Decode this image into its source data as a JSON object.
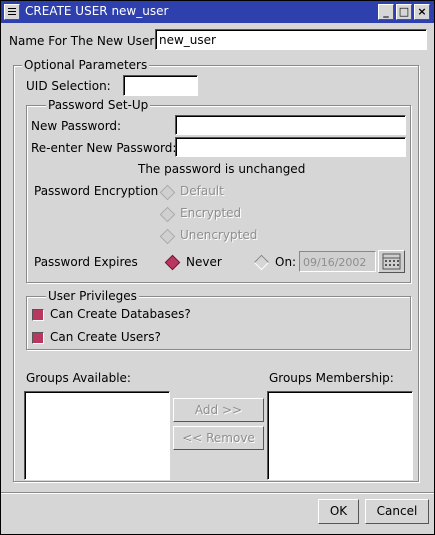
{
  "window": {
    "title": "CREATE USER new_user"
  },
  "name_row": {
    "label": "Name For The New User:",
    "value": "new_user"
  },
  "optional": {
    "legend": "Optional Parameters",
    "uid_label": "UID Selection:",
    "uid_value": ""
  },
  "password": {
    "legend": "Password Set-Up",
    "new_label": "New Password:",
    "new_value": "",
    "reenter_label": "Re-enter New Password:",
    "reenter_value": "",
    "status": "The password is unchanged",
    "encryption_label": "Password Encryption",
    "encryption_options": [
      "Default",
      "Encrypted",
      "Unencrypted"
    ],
    "expires_label": "Password Expires",
    "never_label": "Never",
    "on_label": "On:",
    "date_value": "09/16/2002"
  },
  "privileges": {
    "legend": "User Privileges",
    "create_db": "Can Create Databases?",
    "create_users": "Can Create Users?"
  },
  "groups": {
    "available_label": "Groups Available:",
    "membership_label": "Groups Membership:",
    "add_label": "Add >>",
    "remove_label": "<< Remove"
  },
  "footer": {
    "ok_label": "OK",
    "cancel_label": "Cancel"
  },
  "colors": {
    "titlebar": "#2e3fae",
    "background": "#d6d6d6",
    "checked": "#b9375f"
  },
  "icons": {
    "window_menu": "menu-icon",
    "minimize": "minimize-icon",
    "maximize": "maximize-icon",
    "close": "close-icon",
    "calendar": "calendar-icon"
  }
}
